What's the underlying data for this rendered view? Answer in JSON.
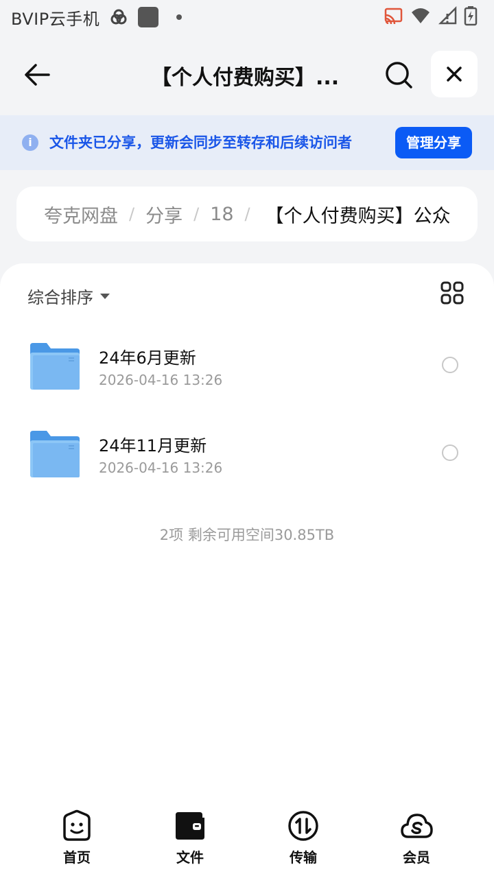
{
  "status_bar": {
    "app_label": "BVIP云手机"
  },
  "header": {
    "title": "【个人付费购买】..."
  },
  "notice": {
    "text": "文件夹已分享，更新会同步至转存和后续访问者",
    "button_label": "管理分享"
  },
  "breadcrumb": {
    "items": [
      "夸克网盘",
      "分享",
      "18"
    ],
    "separator": "/",
    "current": "【个人付费购买】公众"
  },
  "toolbar": {
    "sort_label": "综合排序"
  },
  "files": [
    {
      "name": "24年6月更新",
      "date": "2026-04-16 13:26"
    },
    {
      "name": "24年11月更新",
      "date": "2026-04-16 13:26"
    }
  ],
  "footer_info": "2项 剩余可用空间30.85TB",
  "tabs": [
    {
      "label": "首页",
      "icon": "smile-box-icon"
    },
    {
      "label": "文件",
      "icon": "wallet-folder-icon"
    },
    {
      "label": "传输",
      "icon": "transfer-icon"
    },
    {
      "label": "会员",
      "icon": "cloud-s-icon"
    }
  ],
  "colors": {
    "accent": "#0b5bf5",
    "notice_bg": "#e7edf8",
    "notice_text": "#1a56e8",
    "folder": "#6fb0ee",
    "page_bg": "#f3f4f6"
  }
}
